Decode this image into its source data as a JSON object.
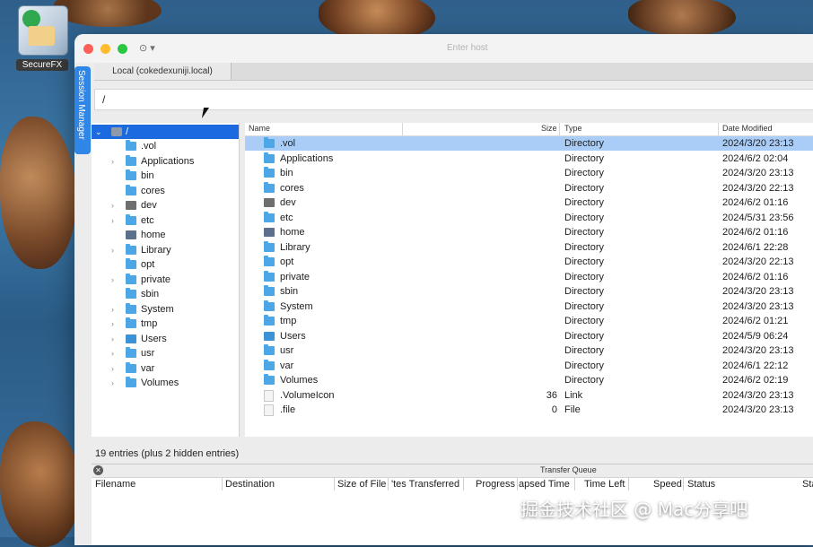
{
  "desktop": {
    "icon_label": "SecureFX",
    "watermark": "掘金技术社区 @ Mac分享吧"
  },
  "window": {
    "host_placeholder": "Enter host",
    "session_manager_label": "Session Manager",
    "tab_label": "Local (cokedexuniji.local)",
    "path": "/"
  },
  "tree": {
    "root_label": "/",
    "items": [
      {
        "label": ".vol",
        "icon": "folder-icon",
        "expandable": false
      },
      {
        "label": "Applications",
        "icon": "folder-icon",
        "expandable": true
      },
      {
        "label": "bin",
        "icon": "folder-icon",
        "expandable": false
      },
      {
        "label": "cores",
        "icon": "folder-icon",
        "expandable": false
      },
      {
        "label": "dev",
        "icon": "device-icon",
        "expandable": true
      },
      {
        "label": "etc",
        "icon": "folder-icon",
        "expandable": true
      },
      {
        "label": "home",
        "icon": "home-icon",
        "expandable": false
      },
      {
        "label": "Library",
        "icon": "folder-icon",
        "expandable": true
      },
      {
        "label": "opt",
        "icon": "folder-icon",
        "expandable": false
      },
      {
        "label": "private",
        "icon": "folder-icon",
        "expandable": true
      },
      {
        "label": "sbin",
        "icon": "folder-icon",
        "expandable": false
      },
      {
        "label": "System",
        "icon": "folder-icon",
        "expandable": true
      },
      {
        "label": "tmp",
        "icon": "folder-icon",
        "expandable": true
      },
      {
        "label": "Users",
        "icon": "users-icon",
        "expandable": true
      },
      {
        "label": "usr",
        "icon": "folder-icon",
        "expandable": true
      },
      {
        "label": "var",
        "icon": "folder-icon",
        "expandable": true
      },
      {
        "label": "Volumes",
        "icon": "folder-icon",
        "expandable": true
      }
    ]
  },
  "list": {
    "headers": {
      "name": "Name",
      "size": "Size",
      "type": "Type",
      "date": "Date Modified"
    },
    "rows": [
      {
        "name": ".vol",
        "size": "",
        "type": "Directory",
        "date": "2024/3/20 23:13",
        "icon": "folder-icon",
        "selected": true
      },
      {
        "name": "Applications",
        "size": "",
        "type": "Directory",
        "date": "2024/6/2 02:04",
        "icon": "folder-icon"
      },
      {
        "name": "bin",
        "size": "",
        "type": "Directory",
        "date": "2024/3/20 23:13",
        "icon": "folder-icon"
      },
      {
        "name": "cores",
        "size": "",
        "type": "Directory",
        "date": "2024/3/20 22:13",
        "icon": "folder-icon"
      },
      {
        "name": "dev",
        "size": "",
        "type": "Directory",
        "date": "2024/6/2 01:16",
        "icon": "device-icon"
      },
      {
        "name": "etc",
        "size": "",
        "type": "Directory",
        "date": "2024/5/31 23:56",
        "icon": "folder-icon"
      },
      {
        "name": "home",
        "size": "",
        "type": "Directory",
        "date": "2024/6/2 01:16",
        "icon": "home-icon"
      },
      {
        "name": "Library",
        "size": "",
        "type": "Directory",
        "date": "2024/6/1 22:28",
        "icon": "folder-icon"
      },
      {
        "name": "opt",
        "size": "",
        "type": "Directory",
        "date": "2024/3/20 22:13",
        "icon": "folder-icon"
      },
      {
        "name": "private",
        "size": "",
        "type": "Directory",
        "date": "2024/6/2 01:16",
        "icon": "folder-icon"
      },
      {
        "name": "sbin",
        "size": "",
        "type": "Directory",
        "date": "2024/3/20 23:13",
        "icon": "folder-icon"
      },
      {
        "name": "System",
        "size": "",
        "type": "Directory",
        "date": "2024/3/20 23:13",
        "icon": "folder-icon"
      },
      {
        "name": "tmp",
        "size": "",
        "type": "Directory",
        "date": "2024/6/2 01:21",
        "icon": "folder-icon"
      },
      {
        "name": "Users",
        "size": "",
        "type": "Directory",
        "date": "2024/5/9 06:24",
        "icon": "users-icon"
      },
      {
        "name": "usr",
        "size": "",
        "type": "Directory",
        "date": "2024/3/20 23:13",
        "icon": "folder-icon"
      },
      {
        "name": "var",
        "size": "",
        "type": "Directory",
        "date": "2024/6/1 22:12",
        "icon": "folder-icon"
      },
      {
        "name": "Volumes",
        "size": "",
        "type": "Directory",
        "date": "2024/6/2 02:19",
        "icon": "folder-icon"
      },
      {
        "name": ".VolumeIcon",
        "size": "36",
        "type": "Link",
        "date": "2024/3/20 23:13",
        "icon": "file-icon"
      },
      {
        "name": ".file",
        "size": "0",
        "type": "File",
        "date": "2024/3/20 23:13",
        "icon": "file-icon"
      }
    ]
  },
  "status": {
    "text": "19 entries (plus 2 hidden entries)"
  },
  "transfer_queue": {
    "title": "Transfer Queue",
    "columns": [
      "Filename",
      "Destination",
      "Size of File",
      "'tes Transferred",
      "Progress",
      "apsed Time",
      "Time Left",
      "Speed",
      "Status",
      "Sta"
    ]
  },
  "colors": {
    "selection_blue": "#1c6ae0",
    "row_highlight": "#a9cdf6",
    "folder": "#4da7e6",
    "session_tab": "#2f86e6"
  }
}
